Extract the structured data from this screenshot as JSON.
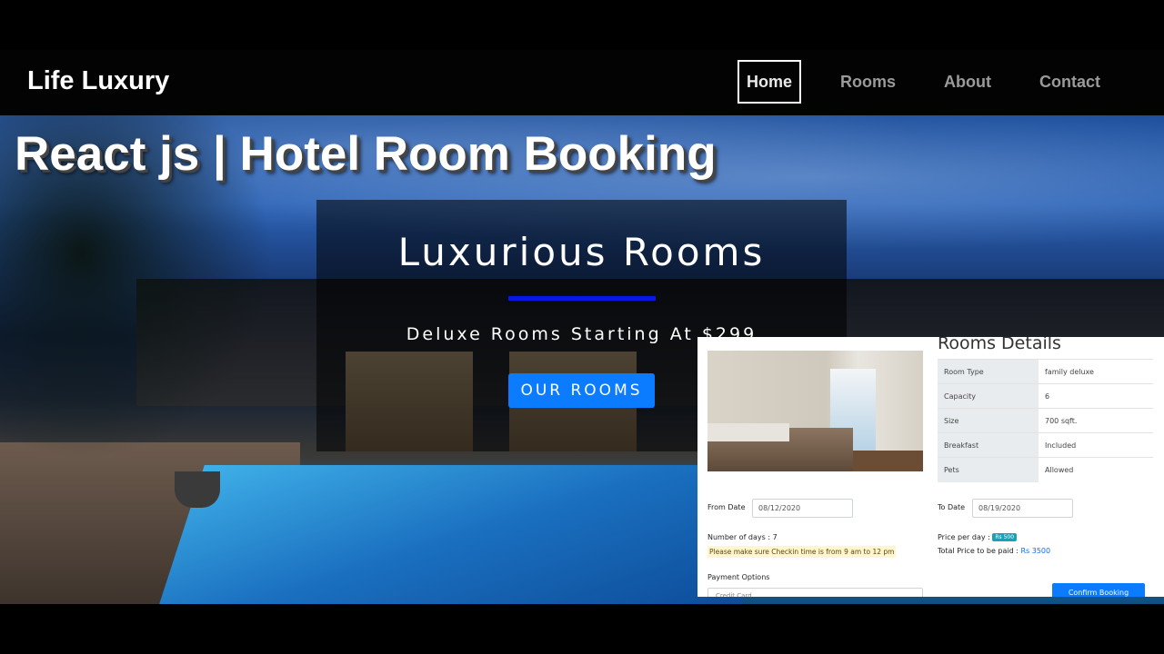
{
  "nav": {
    "brand": "Life Luxury",
    "links": [
      "Home",
      "Rooms",
      "About",
      "Contact"
    ]
  },
  "hero": {
    "video_title": "React js | Hotel Room Booking",
    "heading": "Luxurious Rooms",
    "subheading": "Deluxe Rooms Starting At $299",
    "cta_label": "OUR ROOMS"
  },
  "booking": {
    "details_title": "Rooms Details",
    "details": [
      {
        "key": "Room Type",
        "value": "family deluxe"
      },
      {
        "key": "Capacity",
        "value": "6"
      },
      {
        "key": "Size",
        "value": "700 sqft."
      },
      {
        "key": "Breakfast",
        "value": "Included"
      },
      {
        "key": "Pets",
        "value": "Allowed"
      }
    ],
    "from_label": "From Date",
    "from_value": "08/12/2020",
    "to_label": "To Date",
    "to_value": "08/19/2020",
    "days_text": "Number of days : 7",
    "checkin_note": "Please make sure Checkin time is from 9 am to 12 pm",
    "price_per_day_label": "Price per day :",
    "price_per_day_badge": "Rs 500",
    "total_label": "Total Price to be paid :",
    "total_value": "Rs 3500",
    "payment_label": "Payment Options",
    "payment_selected": "Credit Card",
    "confirm_label": "Confirm Booking"
  },
  "colors": {
    "cta_blue": "#0b7bff",
    "rule_blue": "#0b16e6",
    "badge_teal": "#17a2b8"
  }
}
